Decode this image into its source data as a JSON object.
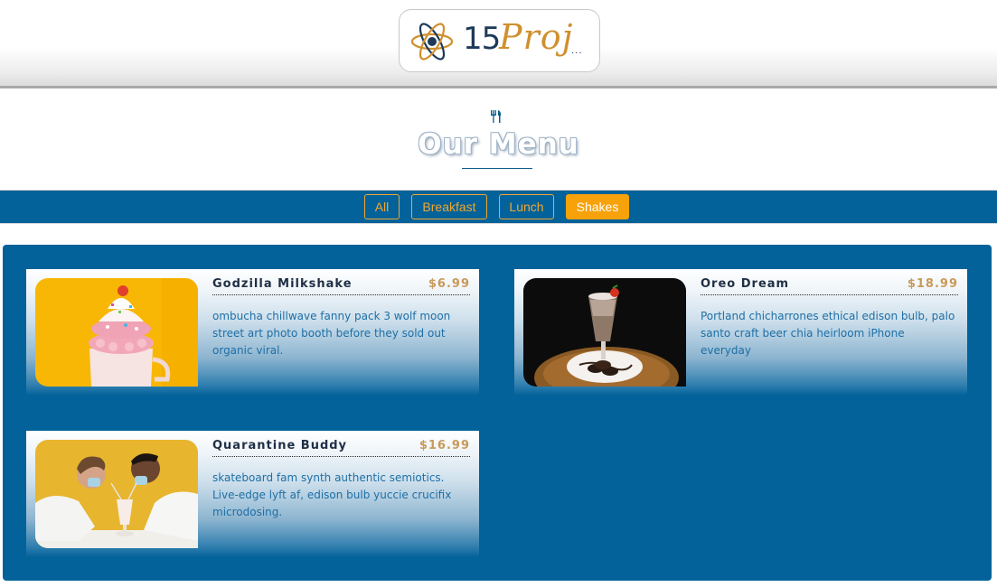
{
  "logo": {
    "number": "15",
    "word": "Proj",
    "dots": "..."
  },
  "section": {
    "icon": "fork-knife-icon",
    "title": "Our Menu"
  },
  "filters": [
    {
      "label": "All",
      "active": false
    },
    {
      "label": "Breakfast",
      "active": false
    },
    {
      "label": "Lunch",
      "active": false
    },
    {
      "label": "Shakes",
      "active": true
    }
  ],
  "items": [
    {
      "name": "Godzilla Milkshake",
      "price": "$6.99",
      "description": "ombucha chillwave fanny pack 3 wolf moon street art photo booth before they sold out organic viral."
    },
    {
      "name": "Oreo Dream",
      "price": "$18.99",
      "description": "Portland chicharrones ethical edison bulb, palo santo craft beer chia heirloom iPhone everyday"
    },
    {
      "name": "Quarantine Buddy",
      "price": "$16.99",
      "description": "skateboard fam synth authentic semiotics. Live-edge lyft af, edison bulb yuccie crucifix microdosing."
    }
  ],
  "colors": {
    "primary": "#03629a",
    "accent": "#f8a20b",
    "price": "#c89a5a",
    "text": "#1d6fa6"
  }
}
